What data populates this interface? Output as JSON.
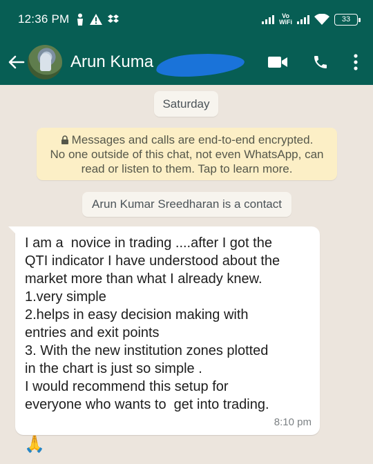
{
  "status_bar": {
    "time": "12:36 PM",
    "vowifi_line1": "Vo",
    "vowifi_line2": "WiFi",
    "battery": "33"
  },
  "app_bar": {
    "contact_name": "Arun Kuma",
    "color": "#075e54"
  },
  "chat": {
    "date_label": "Saturday",
    "encryption_note": [
      "Messages and calls are end-to-end encrypted.",
      "No one outside of this chat, not even WhatsApp, can",
      "read or listen to them. Tap to learn more."
    ],
    "contact_notice": "Arun Kumar Sreedharan is a contact",
    "message": {
      "lines": [
        "I am a  novice in trading ....after I got the",
        "QTI indicator I have understood about the",
        "market more than what I already knew.",
        "1.very simple",
        "2.helps in easy decision making with",
        "entries and exit points",
        "3. With the new institution zones plotted",
        "in the chart is just so simple .",
        "I would recommend this setup for",
        "everyone who wants to  get into trading."
      ],
      "time": "8:10 pm"
    },
    "reaction": "🙏"
  }
}
